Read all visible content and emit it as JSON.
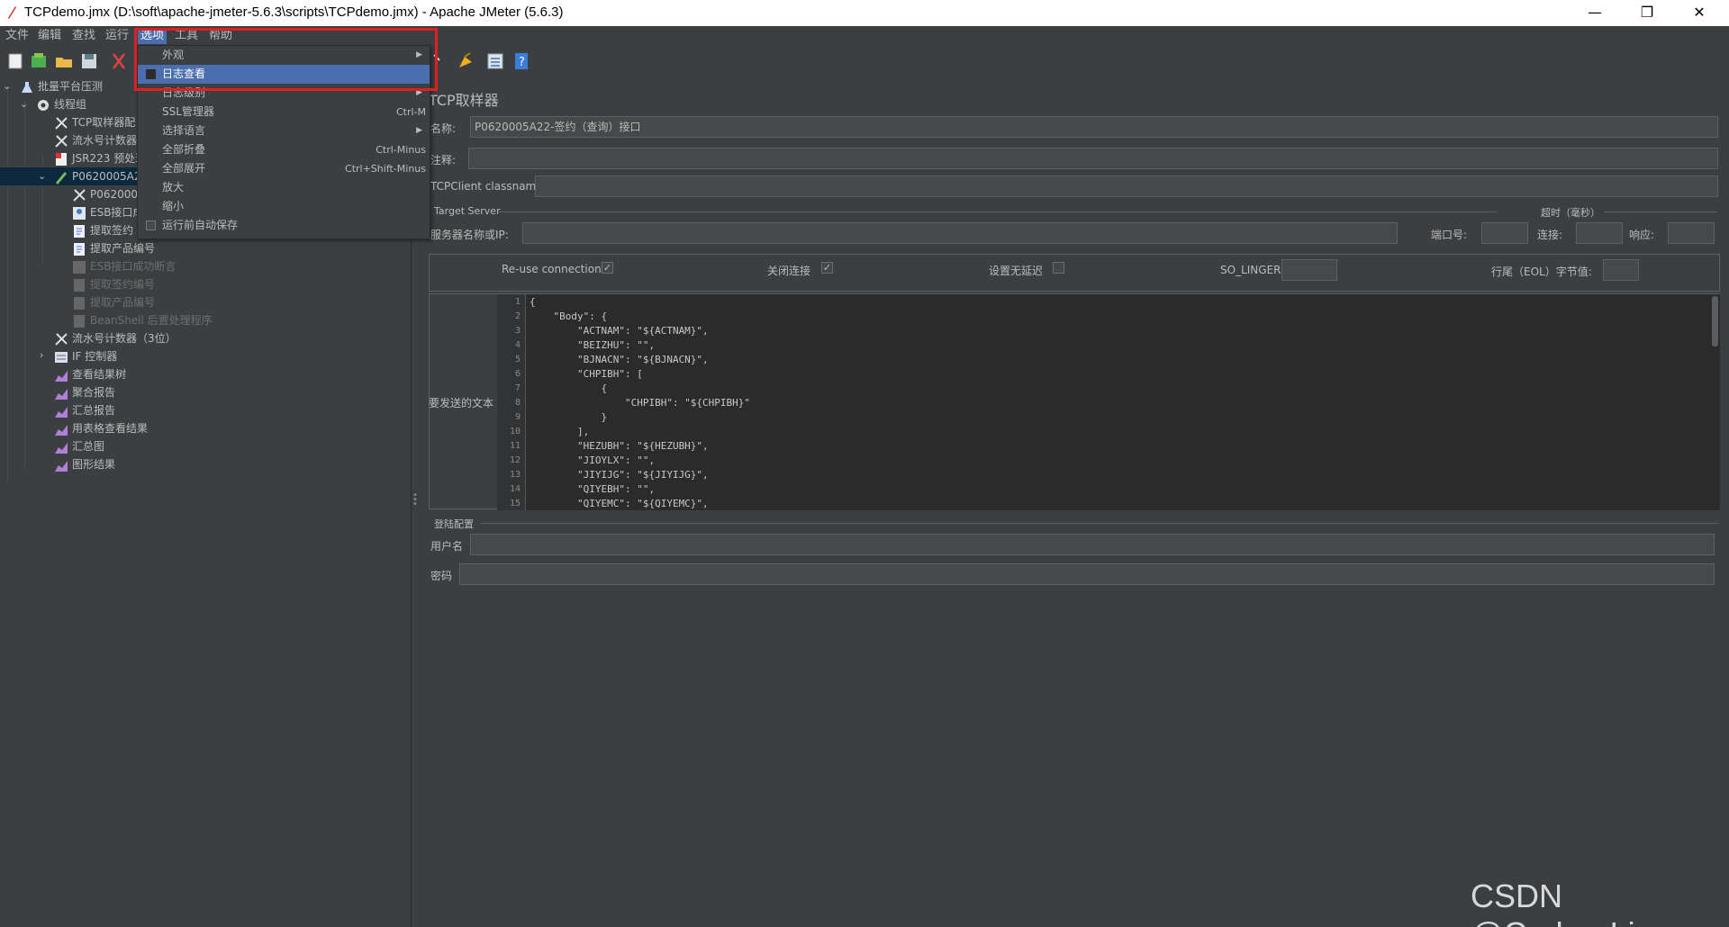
{
  "window": {
    "title": "TCPdemo.jmx (D:\\soft\\apache-jmeter-5.6.3\\scripts\\TCPdemo.jmx) - Apache JMeter (5.6.3)",
    "minimize": "—",
    "maximize": "❐",
    "close": "✕"
  },
  "menubar": [
    "文件",
    "编辑",
    "查找",
    "运行",
    "选项",
    "工具",
    "帮助"
  ],
  "options_menu": {
    "items": [
      {
        "label": "外观",
        "accel": "",
        "submenu": true,
        "checkbox": false
      },
      {
        "label": "日志查看",
        "accel": "",
        "submenu": false,
        "checkbox": true,
        "highlighted": true
      },
      {
        "label": "日志级别",
        "accel": "",
        "submenu": true,
        "checkbox": false
      },
      {
        "label": "SSL管理器",
        "accel": "Ctrl-M",
        "submenu": false,
        "checkbox": false
      },
      {
        "label": "选择语言",
        "accel": "",
        "submenu": true,
        "checkbox": false
      },
      {
        "label": "全部折叠",
        "accel": "Ctrl-Minus",
        "submenu": false,
        "checkbox": false
      },
      {
        "label": "全部展开",
        "accel": "Ctrl+Shift-Minus",
        "submenu": false,
        "checkbox": false
      },
      {
        "label": "放大",
        "accel": "",
        "submenu": false,
        "checkbox": false
      },
      {
        "label": "缩小",
        "accel": "",
        "submenu": false,
        "checkbox": false
      },
      {
        "label": "运行前自动保存",
        "accel": "",
        "submenu": false,
        "checkbox": true
      }
    ]
  },
  "tree": {
    "items": [
      {
        "label": "批量平台压测",
        "icon": "flask-icon",
        "level": 0,
        "expanded": true
      },
      {
        "label": "线程组",
        "icon": "gear-icon",
        "level": 1,
        "expanded": true
      },
      {
        "label": "TCP取样器配",
        "icon": "wrench-icon",
        "level": 2
      },
      {
        "label": "流水号计数器",
        "icon": "wrench-icon",
        "level": 2
      },
      {
        "label": "JSR223 预处理",
        "icon": "script-icon",
        "level": 2
      },
      {
        "label": "P0620005A22",
        "icon": "pencil-icon",
        "level": 2,
        "expanded": true,
        "selected": true
      },
      {
        "label": "P0620005",
        "icon": "wrench-icon",
        "level": 3
      },
      {
        "label": "ESB接口成",
        "icon": "assertion-icon",
        "level": 3
      },
      {
        "label": "提取签约",
        "icon": "extractor-icon",
        "level": 3
      },
      {
        "label": "提取产品编号",
        "icon": "extractor-icon",
        "level": 3
      },
      {
        "label": "ESB接口成功断言",
        "icon": "assertion-icon",
        "level": 3,
        "disabled": true
      },
      {
        "label": "提取签约编号",
        "icon": "extractor-icon",
        "level": 3,
        "disabled": true
      },
      {
        "label": "提取产品编号",
        "icon": "extractor-icon",
        "level": 3,
        "disabled": true
      },
      {
        "label": "BeanShell 后置处理程序",
        "icon": "extractor-icon",
        "level": 3,
        "disabled": true
      },
      {
        "label": "流水号计数器（3位）",
        "icon": "wrench-icon",
        "level": 2
      },
      {
        "label": "IF 控制器",
        "icon": "controller-icon",
        "level": 2,
        "collapsed": true
      },
      {
        "label": "查看结果树",
        "icon": "listener-icon",
        "level": 2
      },
      {
        "label": "聚合报告",
        "icon": "listener-icon",
        "level": 2
      },
      {
        "label": "汇总报告",
        "icon": "listener-icon",
        "level": 2
      },
      {
        "label": "用表格查看结果",
        "icon": "listener-icon",
        "level": 2
      },
      {
        "label": "汇总图",
        "icon": "listener-icon",
        "level": 2
      },
      {
        "label": "图形结果",
        "icon": "listener-icon",
        "level": 2
      }
    ]
  },
  "sampler": {
    "heading": "TCP取样器",
    "name_label": "名称:",
    "name_value": "P0620005A22-签约（查询）接口",
    "comment_label": "注释:",
    "comment_value": "",
    "classname_label": "TCPClient classname:",
    "classname_value": "",
    "target_server_label": "Target Server",
    "server_label": "服务器名称或IP:",
    "server_value": "",
    "port_label": "端口号:",
    "port_value": "",
    "timeout_label": "超时（毫秒）",
    "connect_label": "连接:",
    "connect_value": "",
    "response_label": "响应:",
    "response_value": "",
    "reuse_label": "Re-use connection",
    "reuse_checked": "✓",
    "close_label": "关闭连接",
    "close_checked": "✓",
    "nodelay_label": "设置无延迟",
    "nodelay_checked": "",
    "solinger_label": "SO_LINGER:",
    "solinger_value": "",
    "eol_label": "行尾（EOL）字节值:",
    "eol_value": "",
    "text_to_send_label": "要发送的文本",
    "code_lines": [
      "{",
      "    \"Body\": {",
      "        \"ACTNAM\": \"${ACTNAM}\",",
      "        \"BEIZHU\": \"\",",
      "        \"BJNACN\": \"${BJNACN}\",",
      "        \"CHPIBH\": [",
      "            {",
      "                \"CHPIBH\": \"${CHPIBH}\"",
      "            }",
      "        ],",
      "        \"HEZUBH\": \"${HEZUBH}\",",
      "        \"JIOYLX\": \"\",",
      "        \"JIYIJG\": \"${JIYIJG}\",",
      "        \"QIYEBH\": \"\",",
      "        \"QIYEMC\": \"${QIYEMC}\","
    ],
    "login_config_label": "登陆配置",
    "username_label": "用户名",
    "username_value": "",
    "password_label": "密码",
    "password_value": ""
  },
  "watermark": "CSDN @Coder_Li",
  "colors": {
    "background": "#3c3f41",
    "selection": "#4b6eaf",
    "highlight_box": "#e02020"
  }
}
